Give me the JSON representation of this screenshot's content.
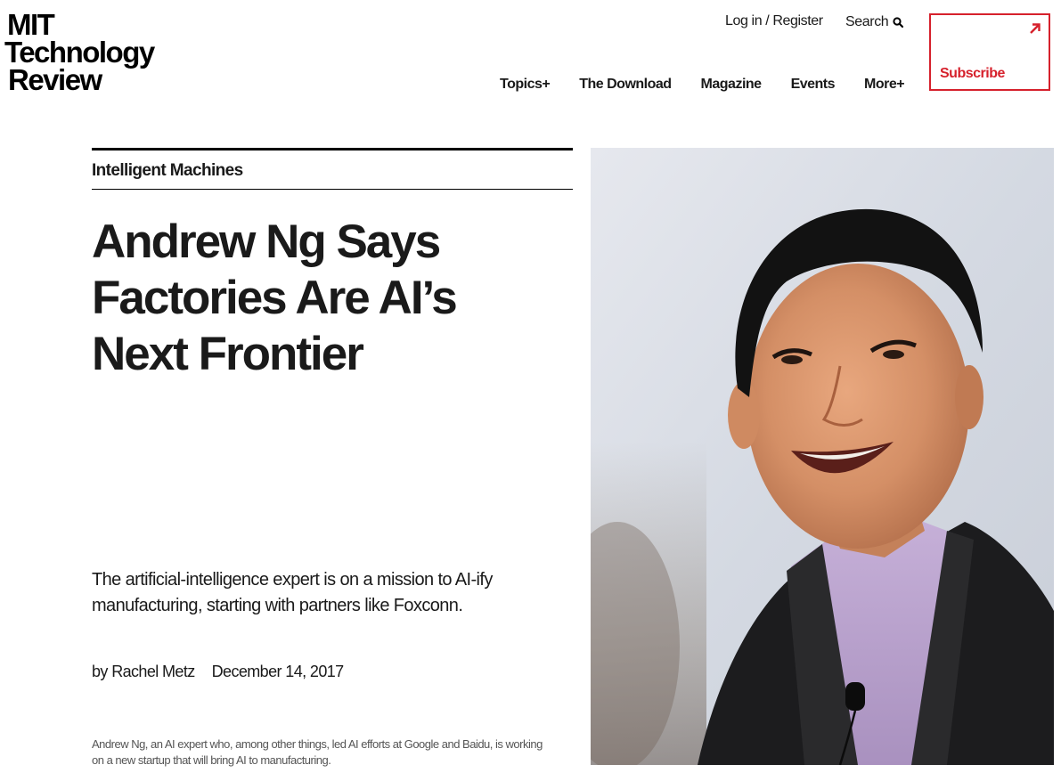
{
  "header": {
    "logo": {
      "line1": "MIT",
      "line2": "Technology",
      "line3": "Review"
    },
    "login_label": "Log in / Register",
    "search_label": "Search",
    "search_icon": "search-icon",
    "subscribe": {
      "label": "Subscribe",
      "icon": "arrow-up-right-icon",
      "color": "#d6212c"
    },
    "nav": [
      {
        "label": "Topics+"
      },
      {
        "label": "The Download"
      },
      {
        "label": "Magazine"
      },
      {
        "label": "Events"
      },
      {
        "label": "More+"
      }
    ]
  },
  "article": {
    "topic": "Intelligent Machines",
    "headline": [
      "Andrew Ng Says",
      "Factories Are AI’s",
      "Next Frontier"
    ],
    "dek": "The artificial-intelligence expert is on a mission to AI-ify manufacturing, starting with partners like Foxconn.",
    "byline": "by Rachel Metz",
    "date": "December 14, 2017",
    "caption": "Andrew Ng, an AI expert who, among other things, led AI efforts at Google and Baidu, is working on a new startup that will bring AI to manufacturing."
  }
}
